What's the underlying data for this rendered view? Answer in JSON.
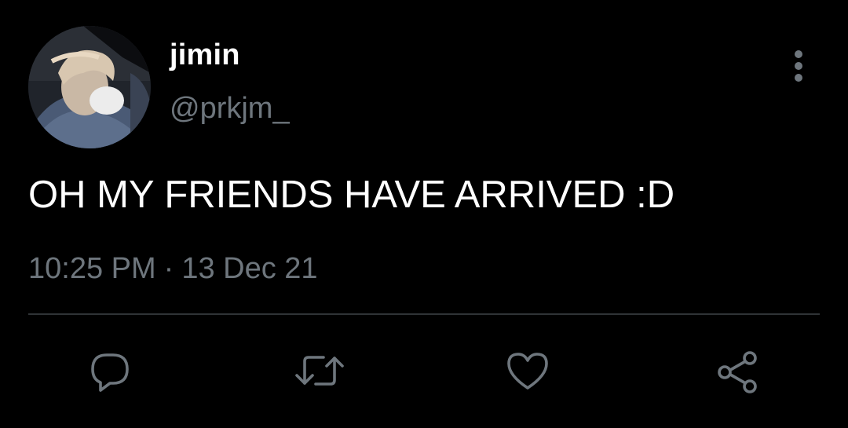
{
  "tweet": {
    "display_name": "jimin",
    "handle": "@prkjm_",
    "text": "OH MY FRIENDS HAVE ARRIVED :D",
    "time": "10:25 PM",
    "separator": "·",
    "date": "13 Dec 21"
  },
  "icons": {
    "more": "more-vertical-icon",
    "reply": "reply-icon",
    "retweet": "retweet-icon",
    "like": "heart-icon",
    "share": "share-icon"
  },
  "colors": {
    "background": "#000000",
    "primary_text": "#ffffff",
    "secondary_text": "#6e767d",
    "divider": "#2f3336",
    "icon": "#6e767d"
  }
}
